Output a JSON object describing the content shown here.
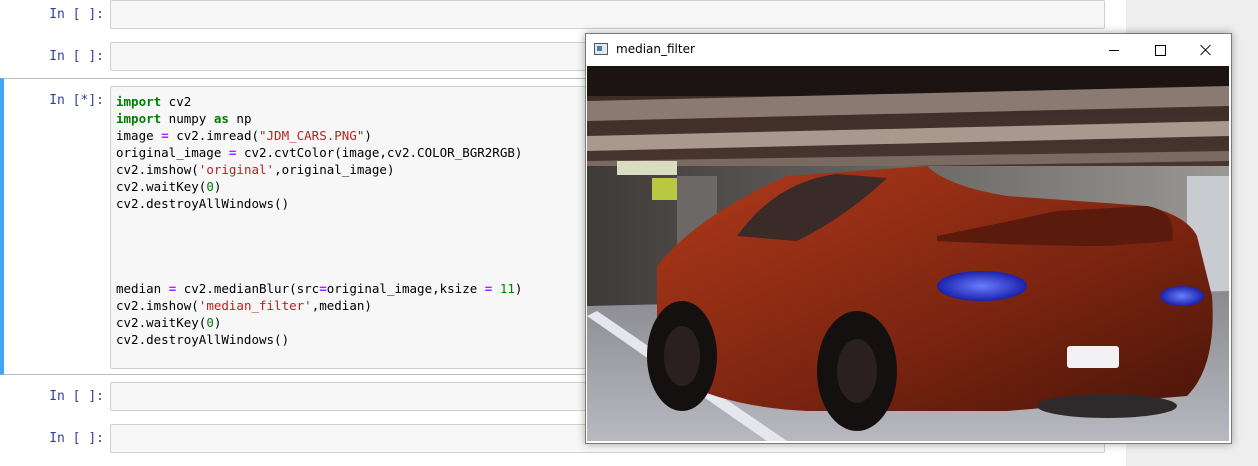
{
  "notebook": {
    "cells": [
      {
        "prompt": "In [ ]:"
      },
      {
        "prompt": "In [ ]:"
      },
      {
        "prompt": "In [*]:",
        "code_lines": [
          [
            {
              "t": "kw",
              "v": "import"
            },
            {
              "t": "n",
              "v": " cv2"
            }
          ],
          [
            {
              "t": "kw",
              "v": "import"
            },
            {
              "t": "n",
              "v": " numpy "
            },
            {
              "t": "kw",
              "v": "as"
            },
            {
              "t": "n",
              "v": " np"
            }
          ],
          [
            {
              "t": "n",
              "v": "image "
            },
            {
              "t": "op",
              "v": "="
            },
            {
              "t": "n",
              "v": " cv2.imread("
            },
            {
              "t": "str",
              "v": "\"JDM_CARS.PNG\""
            },
            {
              "t": "n",
              "v": ")"
            }
          ],
          [
            {
              "t": "n",
              "v": "original_image "
            },
            {
              "t": "op",
              "v": "="
            },
            {
              "t": "n",
              "v": " cv2.cvtColor(image,cv2.COLOR_BGR2RGB)"
            }
          ],
          [
            {
              "t": "n",
              "v": "cv2.imshow("
            },
            {
              "t": "str",
              "v": "'original'"
            },
            {
              "t": "n",
              "v": ",original_image)"
            }
          ],
          [
            {
              "t": "n",
              "v": "cv2.waitKey("
            },
            {
              "t": "num",
              "v": "0"
            },
            {
              "t": "n",
              "v": ")"
            }
          ],
          [
            {
              "t": "n",
              "v": "cv2.destroyAllWindows()"
            }
          ],
          [],
          [],
          [],
          [],
          [
            {
              "t": "n",
              "v": "median "
            },
            {
              "t": "op",
              "v": "="
            },
            {
              "t": "n",
              "v": " cv2.medianBlur(src"
            },
            {
              "t": "op",
              "v": "="
            },
            {
              "t": "n",
              "v": "original_image,ksize "
            },
            {
              "t": "op",
              "v": "="
            },
            {
              "t": "n",
              "v": " "
            },
            {
              "t": "num",
              "v": "11"
            },
            {
              "t": "n",
              "v": ")"
            }
          ],
          [
            {
              "t": "n",
              "v": "cv2.imshow("
            },
            {
              "t": "str",
              "v": "'median_filter'"
            },
            {
              "t": "n",
              "v": ",median)"
            }
          ],
          [
            {
              "t": "n",
              "v": "cv2.waitKey("
            },
            {
              "t": "num",
              "v": "0"
            },
            {
              "t": "n",
              "v": ")"
            }
          ],
          [
            {
              "t": "n",
              "v": "cv2.destroyAllWindows()"
            }
          ]
        ]
      },
      {
        "prompt": "In [ ]:"
      },
      {
        "prompt": "In [ ]:"
      }
    ]
  },
  "window": {
    "title": "median_filter",
    "icons": {
      "app": "opencv-window-icon",
      "minimize": "minimize-icon",
      "maximize": "maximize-icon",
      "close": "close-icon"
    }
  },
  "colors": {
    "selected_cell_bar": "#42a5f5",
    "prompt": "#303f9f",
    "keyword": "#008000",
    "string": "#ba2121"
  }
}
